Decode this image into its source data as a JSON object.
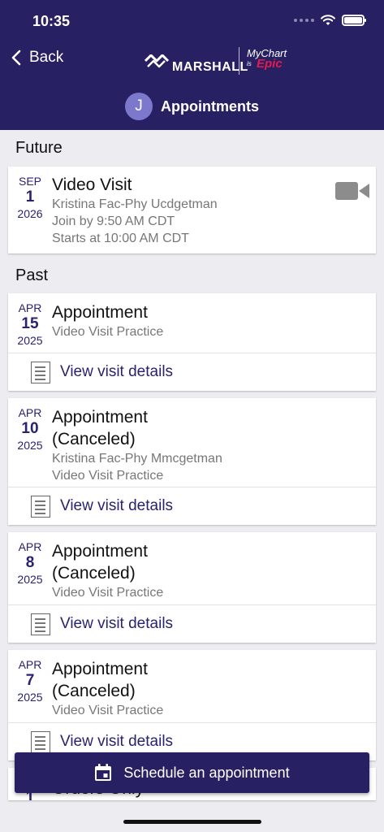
{
  "status_bar": {
    "time": "10:35"
  },
  "header": {
    "back_label": "Back",
    "brand": {
      "org": "MARSHALL",
      "product": "MyChart",
      "epic_prefix": "is",
      "epic": "Epic"
    },
    "avatar_initial": "J",
    "title": "Appointments"
  },
  "sections": {
    "future": "Future",
    "past": "Past"
  },
  "future": [
    {
      "month": "SEP",
      "day": "1",
      "year": "2026",
      "title": "Video Visit",
      "lines": [
        "Kristina Fac-Phy Ucdgetman",
        "Join by 9:50 AM CDT",
        "Starts at 10:00 AM CDT"
      ]
    }
  ],
  "past": [
    {
      "month": "APR",
      "day": "15",
      "year": "2025",
      "title_line1": "Appointment",
      "lines": [
        "Video Visit Practice"
      ],
      "details_label": "View visit details"
    },
    {
      "month": "APR",
      "day": "10",
      "year": "2025",
      "title_line1": "Appointment",
      "title_line2": "(Canceled)",
      "lines": [
        "Kristina Fac-Phy Mmcgetman",
        "Video Visit Practice"
      ],
      "details_label": "View visit details"
    },
    {
      "month": "APR",
      "day": "8",
      "year": "2025",
      "title_line1": "Appointment",
      "title_line2": "(Canceled)",
      "lines": [
        "Video Visit Practice"
      ],
      "details_label": "View visit details"
    },
    {
      "month": "APR",
      "day": "7",
      "year": "2025",
      "title_line1": "Appointment",
      "title_line2": "(Canceled)",
      "lines": [
        "Video Visit Practice"
      ],
      "details_label": "View visit details"
    },
    {
      "day": "1",
      "title_line1": "Orders Only"
    }
  ],
  "schedule_button": {
    "label": "Schedule an appointment"
  },
  "colors": {
    "brand_navy": "#272163",
    "accent_text": "#282271",
    "epic_red": "#e51a4c",
    "avatar": "#7c78cc"
  }
}
